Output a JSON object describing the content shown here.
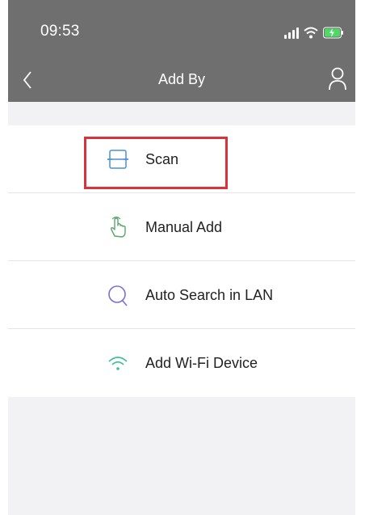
{
  "status_bar": {
    "time": "09:53"
  },
  "nav": {
    "title": "Add By"
  },
  "options": [
    {
      "label": "Scan",
      "icon": "scan-icon",
      "highlighted": true
    },
    {
      "label": "Manual Add",
      "icon": "hand-pointer-icon",
      "highlighted": false
    },
    {
      "label": "Auto Search in LAN",
      "icon": "search-lan-icon",
      "highlighted": false
    },
    {
      "label": "Add Wi-Fi Device",
      "icon": "wifi-icon",
      "highlighted": false
    }
  ],
  "colors": {
    "header_bg": "#6f6f6f",
    "highlight": "#d9323a",
    "scan_icon": "#4a90d9",
    "manual_icon": "#5aa469",
    "search_icon": "#7b6fd6",
    "wifi_icon": "#3dbf9a",
    "battery": "#4cd964"
  }
}
